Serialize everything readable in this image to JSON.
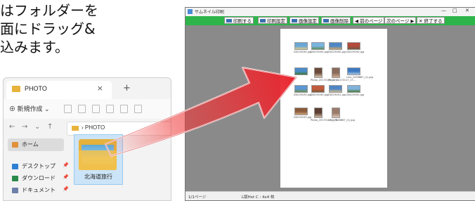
{
  "instruction": {
    "line1": "はフォルダーを",
    "line2": "面にドラッグ&",
    "line3": "込みます。"
  },
  "explorer": {
    "tab_label": "PHOTO",
    "tab_close": "×",
    "new_tab": "+",
    "new_button": "⊕ 新規作成 ⌄",
    "nav_back": "←",
    "nav_forward": "→",
    "nav_down": "⌄",
    "nav_up": "↑",
    "address_path": "› PHOTO",
    "home_label": "ホーム",
    "sidebar_items": [
      {
        "label": "デスクトップ",
        "color": "#2f7fd3"
      },
      {
        "label": "ダウンロード",
        "color": "#2a8a4a"
      },
      {
        "label": "ドキュメント",
        "color": "#6b7fa8"
      }
    ],
    "pin_glyph": "📌",
    "folder_name": "北海道旅行"
  },
  "thumbnail_window": {
    "title": "サムネイル印刷",
    "window_minimize": "—",
    "window_maximize": "□",
    "window_close": "✕",
    "toolbar": {
      "print": "印刷する",
      "print_settings": "印刷設定",
      "image_settings": "画像設定",
      "image_delete": "画像削除",
      "prev_page": "◀ 前のページ",
      "next_page": "次のページ ▶",
      "exit": "✕ 終了する"
    },
    "status_page": "1/1ページ",
    "status_layout": "L版Hxt C : 4x4 枚",
    "accent_color": "#2db54a",
    "thumbnails": [
      {
        "caption": "DSC09190.jpg",
        "kind": "landscape",
        "colors": [
          "#6aa7d8",
          "#d8c98c"
        ]
      },
      {
        "caption": "DSC09190.jpg",
        "kind": "landscape",
        "colors": [
          "#7ab4e0",
          "#5b8f5a"
        ]
      },
      {
        "caption": "DSC09190.jpg",
        "kind": "landscape",
        "colors": [
          "#4d87c7",
          "#c9a56a"
        ]
      },
      {
        "caption": "DSC09190.jpg",
        "kind": "landscape",
        "colors": [
          "#b44a3a",
          "#6e5a40"
        ]
      },
      {
        "caption": "",
        "kind": "landscape",
        "colors": [
          "#4a8cc9",
          "#3e7a3c"
        ]
      },
      {
        "caption": "Photo_20170117_175...",
        "kind": "portrait",
        "colors": [
          "#6a4a3a",
          "#d8c4b0"
        ]
      },
      {
        "caption": "Photo_20170117_17...",
        "kind": "portrait",
        "colors": [
          "#8a6a5a",
          "#caa98e"
        ]
      },
      {
        "caption": "Line_2499887_(1).jpg",
        "kind": "landscape",
        "colors": [
          "#3c79c2",
          "#a7c6e4"
        ]
      },
      {
        "caption": "DSC09193.jpg",
        "kind": "landscape",
        "colors": [
          "#5b97d2",
          "#6c8f4e"
        ]
      },
      {
        "caption": "DSC09190.jpg",
        "kind": "landscape",
        "colors": [
          "#c25a3c",
          "#7c5a3a"
        ]
      },
      {
        "caption": "DSC09191.jpg",
        "kind": "landscape",
        "colors": [
          "#4e86c6",
          "#d2b98a"
        ]
      },
      {
        "caption": "DSC09192.jpg",
        "kind": "landscape",
        "colors": [
          "#7fb3dc",
          "#4d7e3d"
        ]
      },
      {
        "caption": "DSC09193.jpg",
        "kind": "landscape",
        "colors": [
          "#8b5a3a",
          "#cba37a"
        ]
      },
      {
        "caption": "Photo_20170117_175...",
        "kind": "portrait",
        "colors": [
          "#5c3e32",
          "#d0bba5"
        ]
      },
      {
        "caption": "Line_2499887_(1).jpg",
        "kind": "portrait",
        "colors": [
          "#9a7a6a",
          "#dcc4b0"
        ]
      }
    ]
  }
}
